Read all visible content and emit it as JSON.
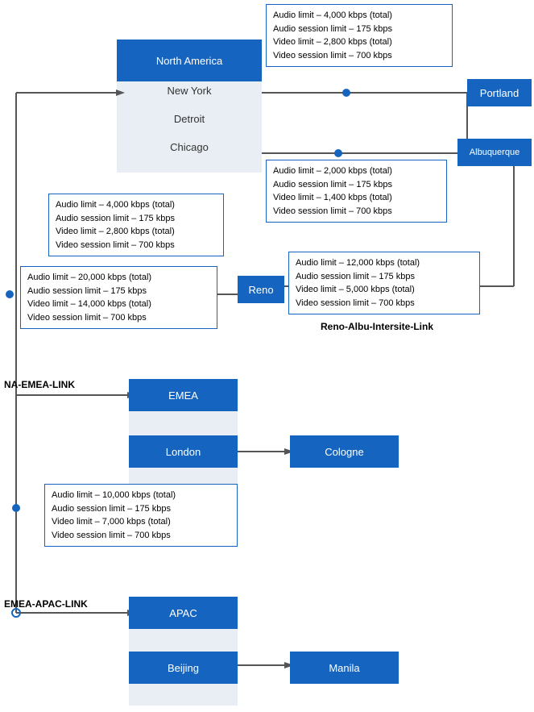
{
  "regions": {
    "north_america": {
      "label": "North America",
      "cities": [
        "New York",
        "Detroit",
        "Chicago"
      ]
    },
    "emea": {
      "label": "EMEA",
      "cities": [
        "London"
      ],
      "subcities": [
        "Cologne"
      ]
    },
    "apac": {
      "label": "APAC",
      "cities": [
        "Beijing"
      ],
      "subcities": [
        "Manila"
      ]
    }
  },
  "nodes": {
    "portland": "Portland",
    "albuquerque": "Albuquerque",
    "reno": "Reno"
  },
  "links": {
    "na_emea": "NA-EMEA-LINK",
    "emea_apac": "EMEA-APAC-LINK",
    "reno_albu": "Reno-Albu-Intersite-Link"
  },
  "info_boxes": {
    "top_right": [
      "Audio limit – 4,000 kbps (total)",
      "Audio session limit – 175 kbps",
      "Video limit – 2,800 kbps (total)",
      "Video session limit – 700 kbps"
    ],
    "na_left_upper": [
      "Audio limit – 4,000 kbps (total)",
      "Audio session limit – 175 kbps",
      "Video limit – 2,800 kbps (total)",
      "Video session limit – 700 kbps"
    ],
    "na_left_lower": [
      "Audio limit – 20,000 kbps  (total)",
      "Audio session limit – 175 kbps",
      "Video limit – 14,000 kbps  (total)",
      "Video session limit – 700 kbps"
    ],
    "chicago_right": [
      "Audio limit – 2,000 kbps (total)",
      "Audio session limit – 175 kbps",
      "Video limit – 1,400 kbps (total)",
      "Video session limit – 700 kbps"
    ],
    "reno_right": [
      "Audio limit – 12,000 kbps  (total)",
      "Audio session limit – 175 kbps",
      "Video limit – 5,000 kbps (total)",
      "Video session limit – 700 kbps"
    ],
    "emea_left": [
      "Audio limit – 10,000 kbps  (total)",
      "Audio session limit – 175 kbps",
      "Video limit – 7,000 kbps  (total)",
      "Video session limit – 700 kbps"
    ]
  }
}
